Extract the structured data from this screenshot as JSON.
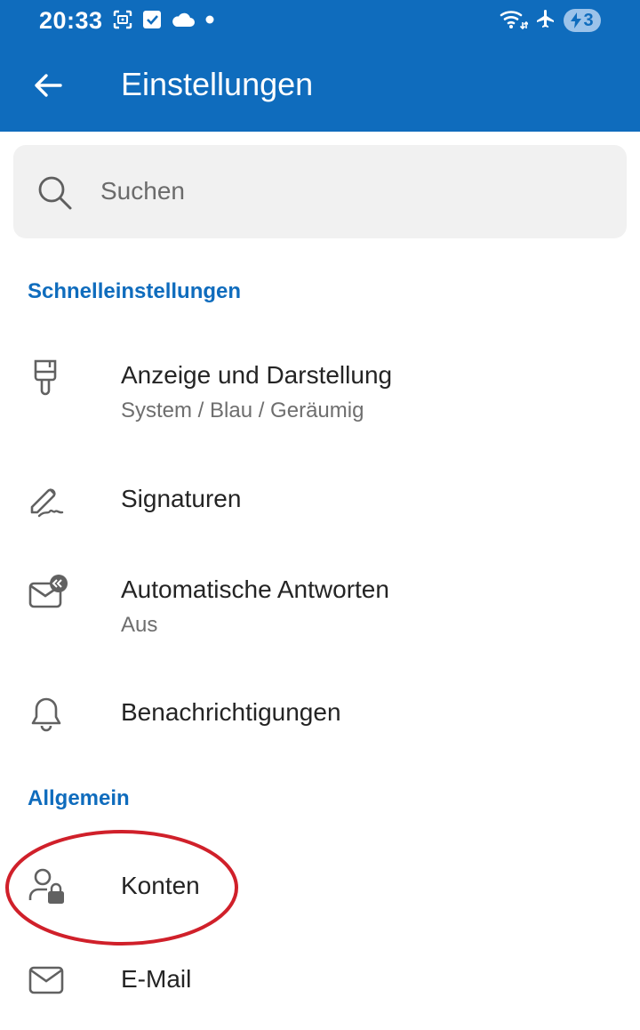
{
  "status_bar": {
    "time": "20:33",
    "left_icons": [
      "screenshot-icon",
      "checkbox-icon",
      "cloud-icon",
      "dot-icon"
    ],
    "right_icons": [
      "wifi-icon",
      "airplane-icon",
      "battery-charging-icon"
    ],
    "wifi_badge": "5",
    "battery_level": "3"
  },
  "app_bar": {
    "title": "Einstellungen",
    "back_icon": "arrow-left-icon"
  },
  "search": {
    "placeholder": "Suchen",
    "value": ""
  },
  "sections": {
    "quick": {
      "header": "Schnelleinstellungen",
      "items": [
        {
          "icon": "paintbrush-icon",
          "title": "Anzeige und Darstellung",
          "subtitle": "System / Blau / Geräumig"
        },
        {
          "icon": "signature-pen-icon",
          "title": "Signaturen",
          "subtitle": ""
        },
        {
          "icon": "mail-auto-reply-icon",
          "title": "Automatische Antworten",
          "subtitle": "Aus"
        },
        {
          "icon": "bell-icon",
          "title": "Benachrichtigungen",
          "subtitle": ""
        }
      ]
    },
    "general": {
      "header": "Allgemein",
      "items": [
        {
          "icon": "person-lock-icon",
          "title": "Konten",
          "subtitle": ""
        },
        {
          "icon": "mail-envelope-icon",
          "title": "E-Mail",
          "subtitle": ""
        }
      ]
    }
  },
  "colors": {
    "accent": "#0f6cbd",
    "highlight": "#d0202a"
  }
}
